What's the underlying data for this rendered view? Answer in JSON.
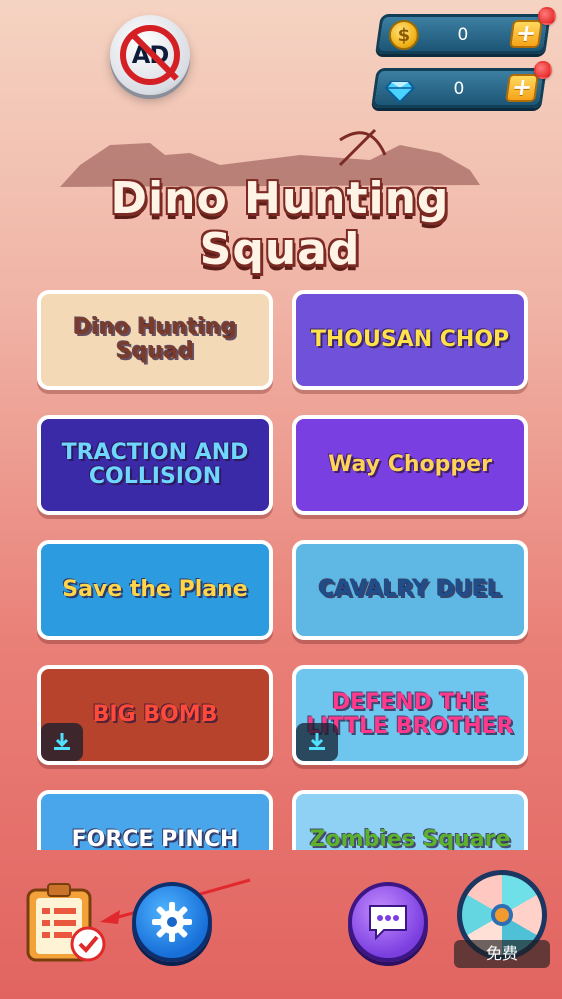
{
  "top": {
    "no_ad_label": "AD",
    "coins": {
      "value": "0",
      "symbol": "$",
      "plus": "+"
    },
    "gems": {
      "value": "0",
      "plus": "+"
    }
  },
  "logo": {
    "title": "Dino Hunting Squad"
  },
  "games": [
    {
      "title": "Dino Hunting Squad",
      "bg": "#f3d9b6",
      "color": "#7b3b2a",
      "download": false
    },
    {
      "title": "THOUSAN CHOP",
      "bg": "#6f52d9",
      "color": "#ffe14a",
      "download": false
    },
    {
      "title": "TRACTION AND COLLISION",
      "bg": "#3b2aa8",
      "color": "#6fd7ff",
      "download": false
    },
    {
      "title": "Way Chopper",
      "bg": "#7a3fe0",
      "color": "#ffd35a",
      "download": false
    },
    {
      "title": "Save the Plane",
      "bg": "#2c9be0",
      "color": "#ffd54a",
      "download": false
    },
    {
      "title": "CAVALRY DUEL",
      "bg": "#5fb8e3",
      "color": "#1d4d8a",
      "download": false
    },
    {
      "title": "BIG BOMB",
      "bg": "#b8432c",
      "color": "#ff4a3a",
      "download": true
    },
    {
      "title": "DEFEND THE LITTLE BROTHER",
      "bg": "#6ec6ef",
      "color": "#ff3a8c",
      "download": true
    },
    {
      "title": "FORCE PINCH",
      "bg": "#4aa6ea",
      "color": "#ffffff",
      "download": false
    },
    {
      "title": "Zombies Square",
      "bg": "#8fd0f5",
      "color": "#5ab22d",
      "download": false
    }
  ],
  "bottom": {
    "free_label": "免费"
  },
  "colors": {
    "accent_orange": "#f5a31a",
    "currency_blue": "#1d5676",
    "badge_red": "#e01a1a"
  }
}
